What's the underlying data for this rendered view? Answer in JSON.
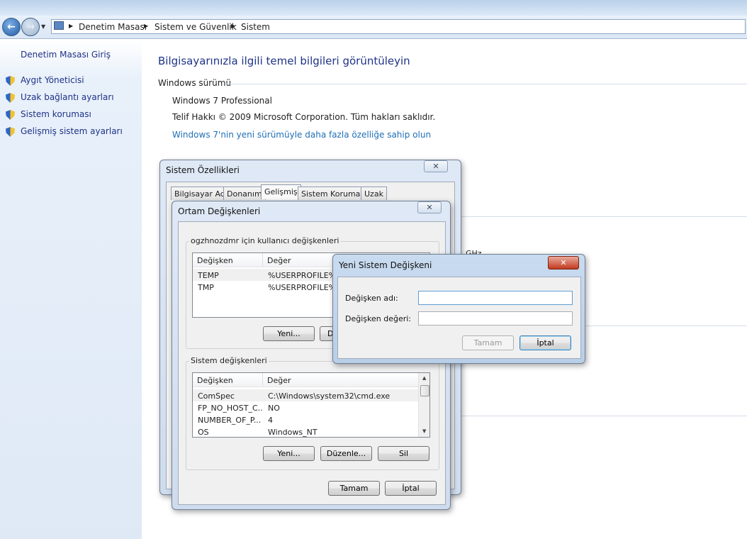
{
  "explorer": {
    "breadcrumb": [
      "Denetim Masası",
      "Sistem ve Güvenlik",
      "Sistem"
    ]
  },
  "sidebar": {
    "home": "Denetim Masası Giriş",
    "items": [
      {
        "label": "Aygıt Yöneticisi",
        "icon": "uac-shield-icon"
      },
      {
        "label": "Uzak bağlantı ayarları",
        "icon": "uac-shield-icon"
      },
      {
        "label": "Sistem koruması",
        "icon": "uac-shield-icon"
      },
      {
        "label": "Gelişmiş sistem ayarları",
        "icon": "uac-shield-icon"
      }
    ]
  },
  "main": {
    "title": "Bilgisayarınızla ilgili temel bilgileri görüntüleyin",
    "edition_header": "Windows sürümü",
    "edition": "Windows 7 Professional",
    "copyright": "Telif Hakkı © 2009 Microsoft Corporation. Tüm hakları saklıdır.",
    "upgrade_link": "Windows 7'nin yeni sürümüyle daha fazla özelliğe sahip olun",
    "partial_ghz": "GHz"
  },
  "system_properties": {
    "title": "Sistem Özellikleri",
    "tabs": [
      "Bilgisayar Adı",
      "Donanım",
      "Gelişmiş",
      "Sistem Koruması",
      "Uzak"
    ],
    "active_tab": "Gelişmiş"
  },
  "env_vars": {
    "title": "Ortam Değişkenleri",
    "user_group": "ogzhnozdmr için kullanıcı değişkenleri",
    "columns": [
      "Değişken",
      "Değer"
    ],
    "user_vars": [
      {
        "name": "TEMP",
        "value": "%USERPROFILE%"
      },
      {
        "name": "TMP",
        "value": "%USERPROFILE%"
      }
    ],
    "user_new": "Yeni...",
    "user_edit_partial": "D",
    "system_group": "Sistem değişkenleri",
    "system_vars": [
      {
        "name": "ComSpec",
        "value": "C:\\Windows\\system32\\cmd.exe"
      },
      {
        "name": "FP_NO_HOST_C...",
        "value": "NO"
      },
      {
        "name": "NUMBER_OF_P...",
        "value": "4"
      },
      {
        "name": "OS",
        "value": "Windows_NT"
      }
    ],
    "sys_new": "Yeni...",
    "sys_edit": "Düzenle...",
    "sys_delete": "Sil",
    "ok": "Tamam",
    "cancel": "İptal"
  },
  "new_var": {
    "title": "Yeni Sistem Değişkeni",
    "name_label": "Değişken adı:",
    "value_label": "Değişken değeri:",
    "name_value": "",
    "value_value": "",
    "ok": "Tamam",
    "cancel": "İptal",
    "close": "✕"
  }
}
